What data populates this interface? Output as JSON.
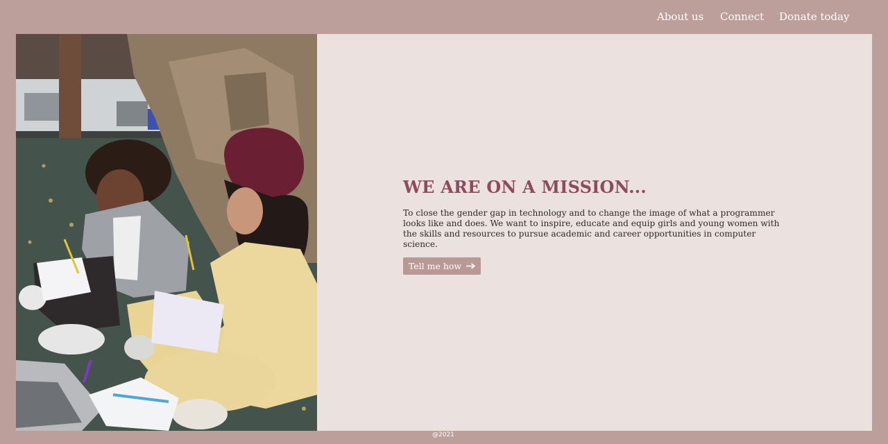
{
  "nav": {
    "items": [
      {
        "label": "About us"
      },
      {
        "label": "Connect"
      },
      {
        "label": "Donate today"
      }
    ]
  },
  "hero": {
    "headline": "WE ARE ON A MISSION...",
    "description": "To close the gender gap in technology and to change the image of what a programmer looks like and does. We want to inspire, educate and equip girls and young women with the skills and resources to pursue academic and career opportunities in computer science.",
    "cta_label": "Tell me how",
    "cta_icon": "arrow-right-icon"
  },
  "footer": {
    "text": "@2021"
  },
  "colors": {
    "page_background": "#bc9e9b",
    "panel_background": "#ebe2df",
    "headline": "#8e4a5e",
    "button": "#b99995"
  }
}
